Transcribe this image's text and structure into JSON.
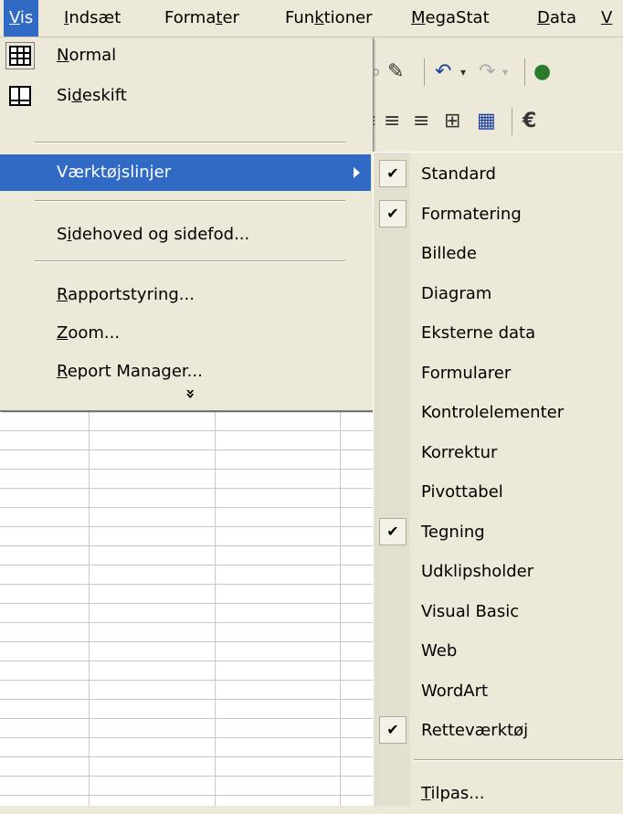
{
  "menubar": {
    "items": [
      {
        "pre": "",
        "ul": "V",
        "post": "is"
      },
      {
        "pre": "",
        "ul": "I",
        "post": "ndsæt"
      },
      {
        "pre": "Forma",
        "ul": "t",
        "post": "er"
      },
      {
        "pre": "Fun",
        "ul": "k",
        "post": "tioner"
      },
      {
        "pre": "",
        "ul": "M",
        "post": "egaStat"
      },
      {
        "pre": "",
        "ul": "D",
        "post": "ata"
      },
      {
        "pre": "",
        "ul": "V",
        "post": ""
      }
    ]
  },
  "vis_menu": {
    "normal": {
      "pre": "",
      "ul": "N",
      "post": "ormal",
      "icon": "grid-icon"
    },
    "sideskift": {
      "pre": "Si",
      "ul": "d",
      "post": "eskift",
      "icon": "page-break-icon"
    },
    "vaerktojslinjer": {
      "label": "Værktøjslinjer"
    },
    "sidehoved": {
      "pre": "S",
      "ul": "i",
      "post": "dehoved og sidefod..."
    },
    "rapportstyring": {
      "pre": "",
      "ul": "R",
      "post": "apportstyring..."
    },
    "zoom": {
      "pre": "",
      "ul": "Z",
      "post": "oom..."
    },
    "report_manager": {
      "pre": "",
      "ul": "R",
      "post": "eport Manager..."
    },
    "expand": "»"
  },
  "toolbars_submenu": {
    "items": [
      {
        "label": "Standard",
        "checked": true
      },
      {
        "label": "Formatering",
        "checked": true
      },
      {
        "label": "Billede",
        "checked": false
      },
      {
        "label": "Diagram",
        "checked": false
      },
      {
        "label": "Eksterne data",
        "checked": false
      },
      {
        "label": "Formularer",
        "checked": false
      },
      {
        "label": "Kontrolelementer",
        "checked": false
      },
      {
        "label": "Korrektur",
        "checked": false
      },
      {
        "label": "Pivottabel",
        "checked": false
      },
      {
        "label": "Tegning",
        "checked": true
      },
      {
        "label": "Udklipsholder",
        "checked": false
      },
      {
        "label": "Visual Basic",
        "checked": false
      },
      {
        "label": "Web",
        "checked": false
      },
      {
        "label": "WordArt",
        "checked": false
      },
      {
        "label": "Retteværktøj",
        "checked": true
      }
    ],
    "customize": {
      "pre": "",
      "ul": "T",
      "post": "ilpas..."
    }
  },
  "colors": {
    "highlight": "#316ac5",
    "menu_bg": "#ece9d8"
  }
}
